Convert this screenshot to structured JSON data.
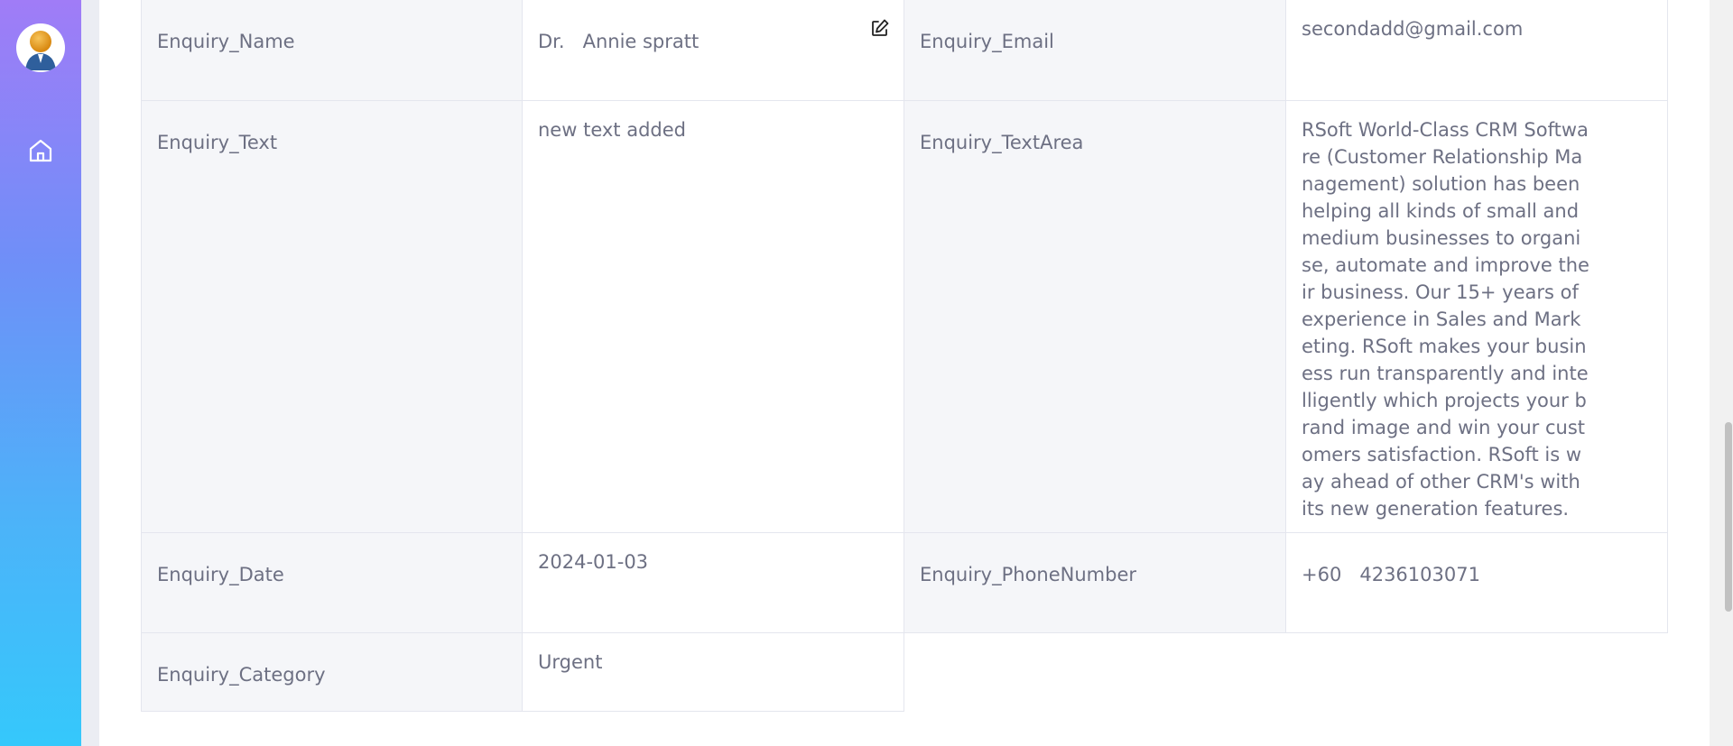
{
  "sidebar": {
    "avatar_icon": "user-avatar-icon",
    "home_icon": "home-icon"
  },
  "colors": {
    "sidebar_top": "#a07cf7",
    "sidebar_bottom": "#35c8fb",
    "label_bg": "#f5f6f9",
    "border": "#e4e6ee",
    "text": "#6d7083"
  },
  "fields": {
    "name": {
      "label": "Enquiry_Name",
      "value": "Dr.   Annie spratt",
      "edit_icon": "edit-icon"
    },
    "email": {
      "label": "Enquiry_Email",
      "value": "secondadd@gmail.com"
    },
    "text": {
      "label": "Enquiry_Text",
      "value": "new text added"
    },
    "textarea": {
      "label": "Enquiry_TextArea",
      "value": "RSoft World-Class CRM Software (Customer Relationship Management) solution has been helping all kinds of small and medium businesses to organise, automate and improve their business. Our 15+ years of experience in Sales and Marketing. RSoft makes your business run transparently and intelligently which projects your brand image and win your customers satisfaction. RSoft is way ahead of other CRM's with its new generation features."
    },
    "date": {
      "label": "Enquiry_Date",
      "value": "2024-01-03"
    },
    "phone": {
      "label": "Enquiry_PhoneNumber",
      "value": "+60   4236103071"
    },
    "category": {
      "label": "Enquiry_Category",
      "value": "Urgent"
    }
  }
}
